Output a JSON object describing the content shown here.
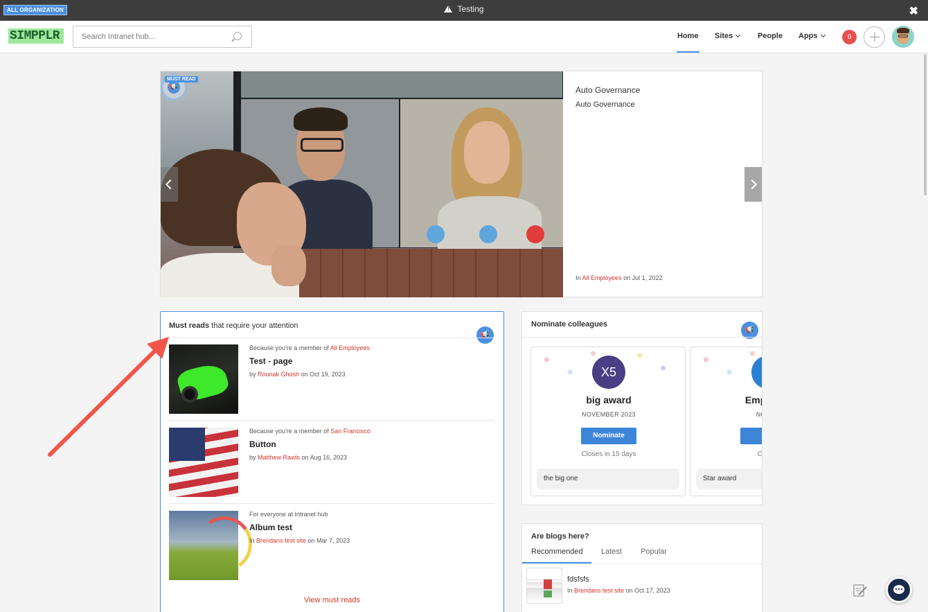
{
  "topbar": {
    "org_badge": "ALL ORGANIZATION",
    "environment": "Testing",
    "close_glyph": "✖"
  },
  "header": {
    "logo_text": "SIMPPLR",
    "search_placeholder": "Search Intranet hub...",
    "nav": [
      {
        "label": "Home",
        "active": true
      },
      {
        "label": "Sites",
        "dropdown": true
      },
      {
        "label": "People"
      },
      {
        "label": "Apps",
        "dropdown": true
      }
    ],
    "notification_count": "6"
  },
  "hero": {
    "tag": "MUST READ",
    "title": "Auto Governance",
    "subtitle": "Auto Governance",
    "meta_prefix": "In",
    "meta_link": "All Employees",
    "meta_suffix": "on Jul 1, 2022"
  },
  "must_reads": {
    "heading_bold": "Must reads",
    "heading_rest": "that require your attention",
    "items": [
      {
        "context_prefix": "Because you're a member of",
        "context_link": "All Employees",
        "title": "Test - page",
        "meta_prefix": "by",
        "meta_link": "Rounak Ghosh",
        "meta_suffix": "on Oct 19, 2023"
      },
      {
        "context_prefix": "Because you're a member of",
        "context_link": "San Francisco",
        "title": "Button",
        "meta_prefix": "by",
        "meta_link": "Matthew Rawls",
        "meta_suffix": "on Aug 16, 2023"
      },
      {
        "context_prefix": "For everyone at Intranet hub",
        "context_link": "",
        "title": "Album test",
        "meta_prefix": "In",
        "meta_link": "Brendans test site",
        "meta_suffix": "on Mar 7, 2023"
      }
    ],
    "view_all": "View must reads"
  },
  "nominate": {
    "heading": "Nominate colleagues",
    "awards": [
      {
        "badge": "X5",
        "name": "big award",
        "month": "NOVEMBER 2023",
        "button": "Nominate",
        "closes": "Closes in 15 days",
        "description": "the big one"
      },
      {
        "badge": "★",
        "name": "Employee",
        "month": "NOVEM",
        "button": "No",
        "closes": "Closes",
        "description": "Star award"
      }
    ]
  },
  "blogs": {
    "heading": "Are blogs here?",
    "tabs": [
      "Recommended",
      "Latest",
      "Popular"
    ],
    "active_tab": "Recommended",
    "post": {
      "title": "fdsfsfs",
      "meta_prefix": "In",
      "meta_link": "Brendans test site",
      "meta_suffix": "on Oct 17, 2023"
    }
  },
  "colors": {
    "accent": "#4a90e2",
    "link": "#d0362b",
    "annotation_arrow": "#f0574a",
    "topbar": "#3d3d3d"
  },
  "icons": {
    "search": "search-icon",
    "megaphone": "megaphone-icon",
    "chat": "chat-icon",
    "edit": "edit-icon",
    "plus": "plus-icon"
  }
}
